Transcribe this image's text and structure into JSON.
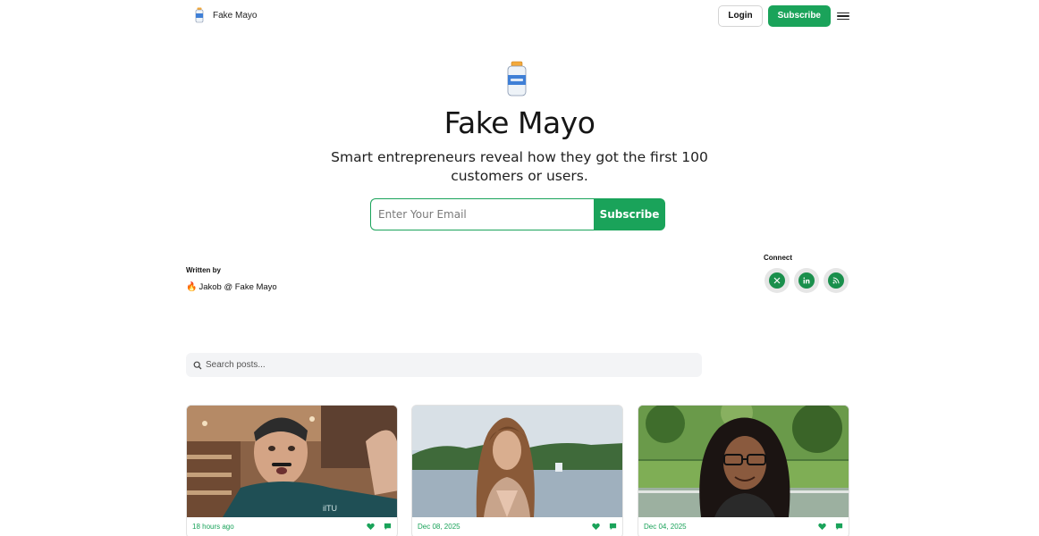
{
  "nav": {
    "brand_name": "Fake Mayo",
    "login_label": "Login",
    "subscribe_label": "Subscribe"
  },
  "hero": {
    "title": "Fake Mayo",
    "subtitle": "Smart entrepreneurs reveal how they got the first 100 customers or users.",
    "email_placeholder": "Enter Your Email",
    "subscribe_label": "Subscribe"
  },
  "author": {
    "label": "Written by",
    "name": "Jakob @ Fake Mayo",
    "emoji": "🔥"
  },
  "connect": {
    "label": "Connect",
    "icons": [
      "x-icon",
      "linkedin-icon",
      "rss-icon"
    ]
  },
  "search": {
    "placeholder": "Search posts..."
  },
  "posts": [
    {
      "date": "18 hours ago"
    },
    {
      "date": "Dec 08, 2025"
    },
    {
      "date": "Dec 04, 2025"
    }
  ],
  "colors": {
    "accent": "#1aa35a",
    "social": "#1a8f4c"
  }
}
